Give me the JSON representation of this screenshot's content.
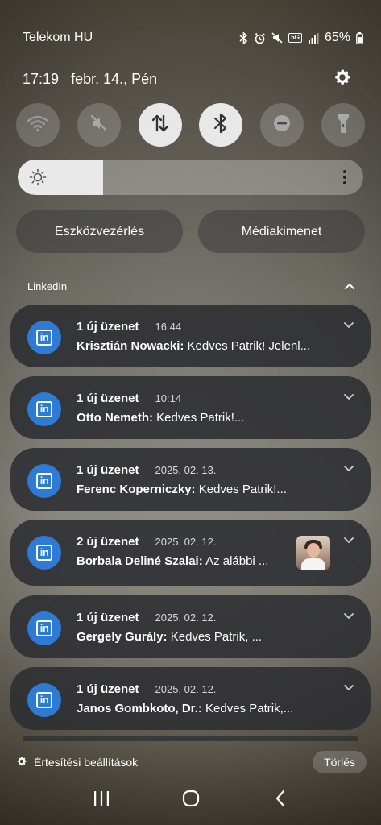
{
  "status": {
    "carrier": "Telekom HU",
    "network_badge": "5G",
    "battery": "65%"
  },
  "header": {
    "time": "17:19",
    "date": "febr. 14., Pén"
  },
  "quick_settings": [
    {
      "icon": "wifi-icon",
      "active": false
    },
    {
      "icon": "mute-icon",
      "active": false
    },
    {
      "icon": "mobile-data-icon",
      "active": true
    },
    {
      "icon": "bluetooth-icon",
      "active": true
    },
    {
      "icon": "do-not-disturb-icon",
      "active": false
    },
    {
      "icon": "flashlight-icon",
      "active": false
    }
  ],
  "brightness": {
    "level": 0.25
  },
  "pills": {
    "device_control": "Eszközvezérlés",
    "media_output": "Médiakimenet"
  },
  "group": {
    "app_name": "LinkedIn"
  },
  "notifications": [
    {
      "title": "1 új üzenet",
      "time": "16:44",
      "sender": "Krisztián Nowacki:",
      "text": "Kedves Patrik! Jelenl..."
    },
    {
      "title": "1 új üzenet",
      "time": "10:14",
      "sender": "Otto Nemeth:",
      "text": "Kedves Patrik!..."
    },
    {
      "title": "1 új üzenet",
      "time": "2025. 02. 13.",
      "sender": "Ferenc Koperniczky:",
      "text": "Kedves Patrik!..."
    },
    {
      "title": "2 új üzenet",
      "time": "2025. 02. 12.",
      "sender": "Borbala Deliné Szalai:",
      "text": "Az alábbi ..."
    },
    {
      "title": "1 új üzenet",
      "time": "2025. 02. 12.",
      "sender": "Gergely Gurály:",
      "text": "Kedves Patrik, ..."
    },
    {
      "title": "1 új üzenet",
      "time": "2025. 02. 12.",
      "sender": "Janos Gombkoto, Dr.:",
      "text": "Kedves Patrik,..."
    }
  ],
  "footer": {
    "settings_label": "Értesítési beállítások",
    "clear_label": "Törlés"
  },
  "colors": {
    "linkedin_blue": "#2d7bd4",
    "card_bg": "#2c2d32",
    "active_toggle": "#e8e8e8"
  }
}
